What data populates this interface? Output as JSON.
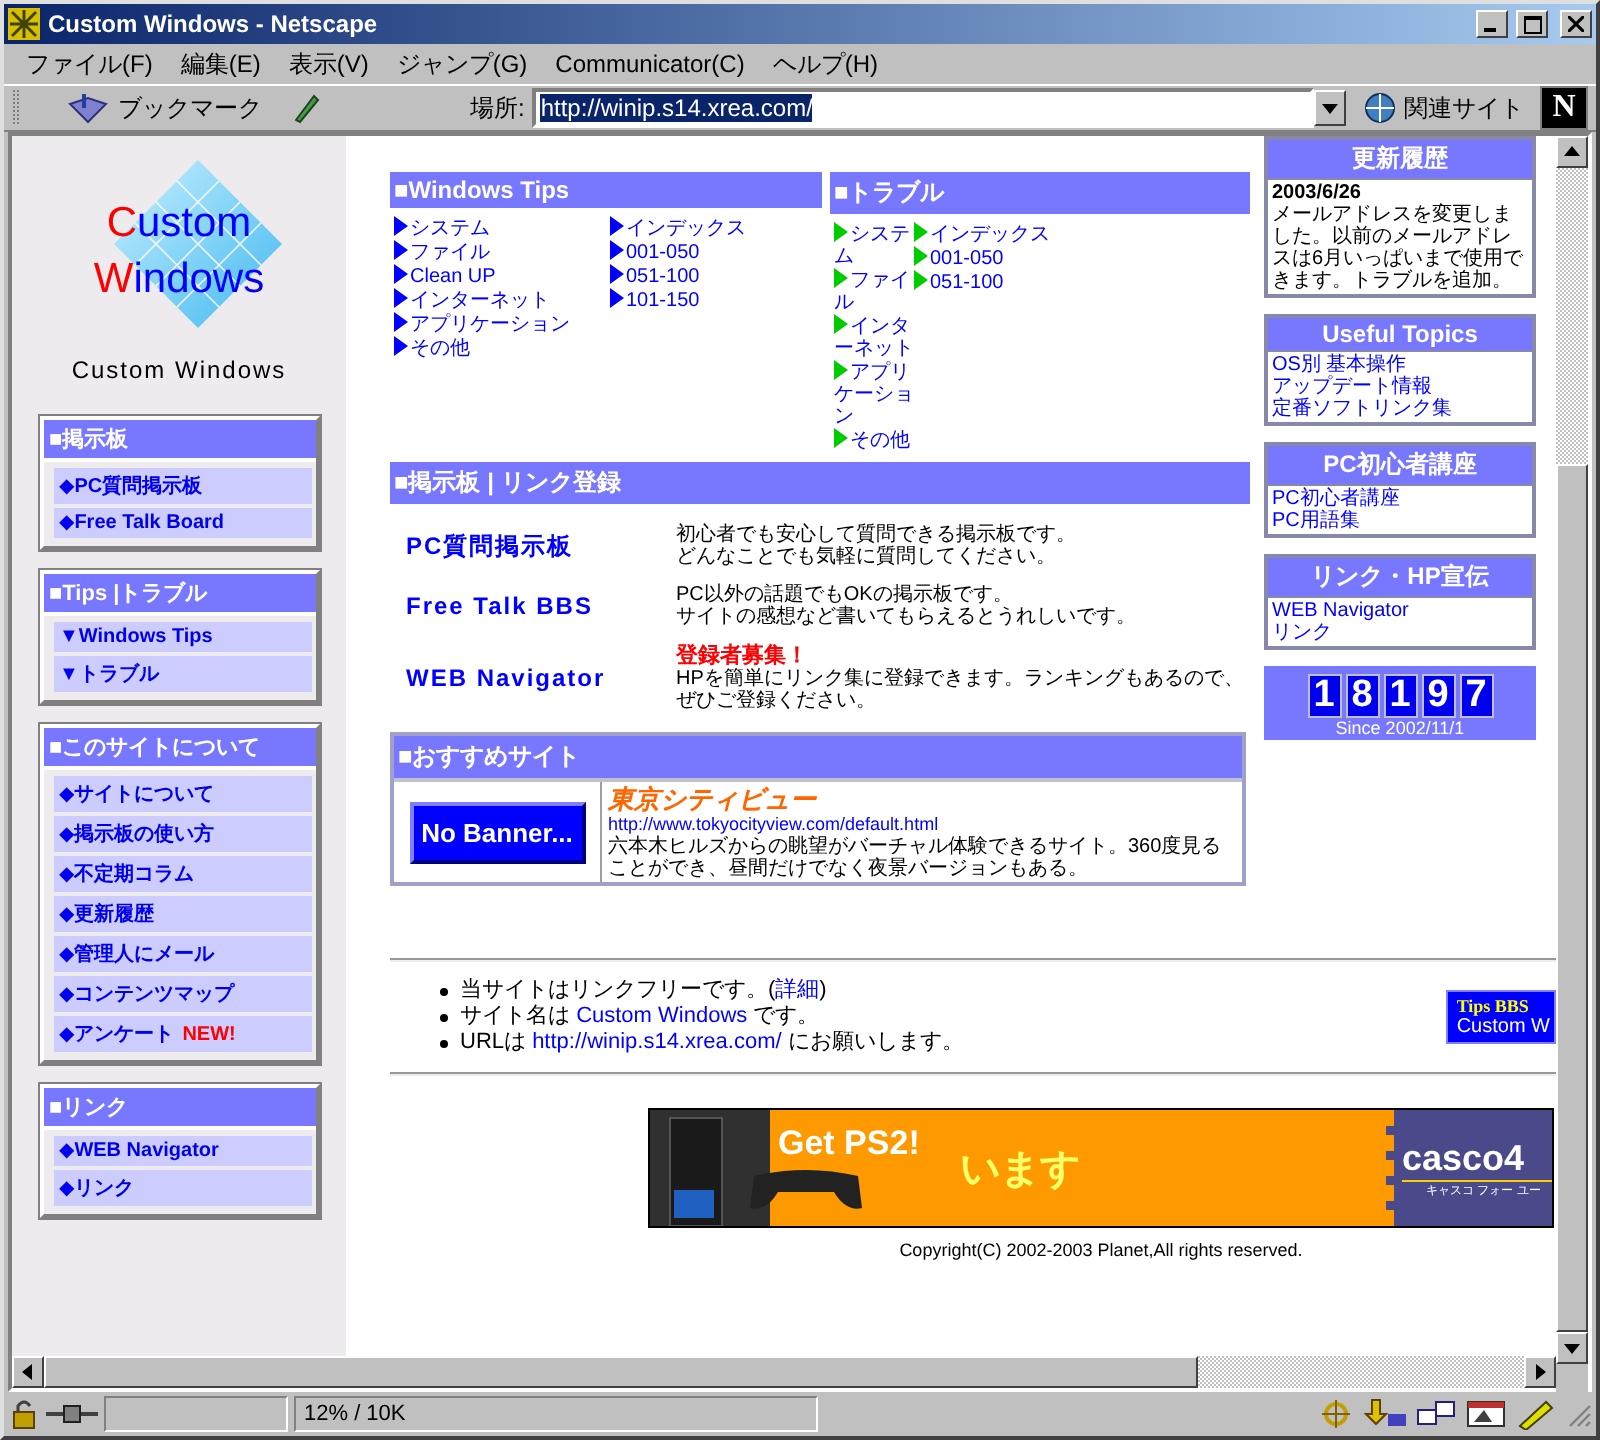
{
  "window": {
    "title": "Custom Windows - Netscape"
  },
  "menu": [
    "ファイル(F)",
    "編集(E)",
    "表示(V)",
    "ジャンプ(G)",
    "Communicator(C)",
    "ヘルプ(H)"
  ],
  "toolbar": {
    "bookmarks": "ブックマーク",
    "location_label": "場所:",
    "url": "http://winip.s14.xrea.com/",
    "url_selected": true,
    "related": "関連サイト",
    "logo": "N"
  },
  "sidebar": {
    "logo": {
      "line1": "Custom",
      "line2": "Windows",
      "caption": "Custom Windows"
    },
    "boxes": [
      {
        "title": "■掲示板",
        "items": [
          {
            "label": "◆PC質問掲示板"
          },
          {
            "label": "◆Free Talk Board"
          }
        ]
      },
      {
        "title": "■Tips |トラブル",
        "items": [
          {
            "label": "▼Windows Tips"
          },
          {
            "label": "▼トラブル"
          }
        ]
      },
      {
        "title": "■このサイトについて",
        "items": [
          {
            "label": "◆サイトについて"
          },
          {
            "label": "◆掲示板の使い方"
          },
          {
            "label": "◆不定期コラム"
          },
          {
            "label": "◆更新履歴"
          },
          {
            "label": "◆管理人にメール"
          },
          {
            "label": "◆コンテンツマップ"
          },
          {
            "label": "◆アンケート",
            "badge": "NEW!"
          }
        ]
      },
      {
        "title": "■リンク",
        "items": [
          {
            "label": "◆WEB Navigator"
          },
          {
            "label": "◆リンク"
          }
        ]
      }
    ]
  },
  "tips": [
    {
      "title": "■Windows Tips",
      "kind": "wide",
      "color": "#0000ff",
      "columns": [
        [
          "システム",
          "ファイル",
          "Clean UP",
          "インターネット",
          "アプリケーション",
          "その他"
        ],
        [
          "インデックス",
          "001-050",
          "051-100",
          "101-150"
        ]
      ]
    },
    {
      "title": "■トラブル",
      "kind": "narrow",
      "color": "#00cc00",
      "columns": [
        [
          "システム",
          "ファイル",
          "インターネット",
          "アプリケーション",
          "その他"
        ],
        [
          "インデックス",
          "001-050",
          "051-100"
        ]
      ]
    }
  ],
  "bbs": {
    "title": "■掲示板 | リンク登録",
    "rows": [
      {
        "name": "PC質問掲示板",
        "description": [
          "初心者でも安心して質問できる掲示板です。",
          "どんなことでも気軽に質問してください。"
        ]
      },
      {
        "name": "Free Talk BBS",
        "description": [
          "PC以外の話題でもOKの掲示板です。",
          "サイトの感想など書いてもらえるとうれしいです。"
        ]
      },
      {
        "name": "WEB Navigator",
        "notice": "登録者募集！",
        "description": [
          "HPを簡単にリンク集に登録できます。ランキングもあるので、ぜひご登録ください。"
        ]
      }
    ]
  },
  "recommend": {
    "title": "■おすすめサイト",
    "banner": "No Banner...",
    "site_name": "東京シティビュー",
    "url": "http://www.tokyocityview.com/default.html",
    "description": "六本木ヒルズからの眺望がバーチャル体験できるサイト。360度見ることができ、昼間だけでなく夜景バージョンもある。"
  },
  "updates": {
    "title": "更新履歴",
    "date": "2003/6/26",
    "text": "メールアドレスを変更しました。以前のメールアドレスは6月いっぱいまで使用できます。トラブルを追加。"
  },
  "link_boxes": [
    {
      "title": "Useful Topics",
      "links": [
        "OS別 基本操作",
        "アップデート情報",
        "定番ソフトリンク集"
      ]
    },
    {
      "title": "PC初心者講座",
      "links": [
        "PC初心者講座",
        "PC用語集"
      ]
    },
    {
      "title": "リンク・HP宣伝",
      "links": [
        "WEB Navigator",
        "リンク"
      ]
    }
  ],
  "counter": {
    "digits": [
      "1",
      "8",
      "1",
      "9",
      "7"
    ],
    "since": "Since 2002/11/1"
  },
  "footer": {
    "items": [
      {
        "before": "当サイトはリンクフリーです。(",
        "link": "詳細",
        "after": ")"
      },
      {
        "before": "サイト名は ",
        "link": "Custom Windows",
        "after": "  です。"
      },
      {
        "before": "URLは ",
        "link": "http://winip.s14.xrea.com/",
        "after": " にお願いします。"
      }
    ],
    "badge": {
      "line1": "Tips BBS",
      "line2": "Custom W"
    },
    "ad": {
      "headline": "Get PS2!",
      "slogan": "います",
      "brand": "casco4",
      "brand_kana": "キャスコ フォー ユー"
    },
    "copyright": "Copyright(C) 2002-2003 Planet,All rights reserved."
  },
  "status": {
    "text": "12% / 10K"
  }
}
